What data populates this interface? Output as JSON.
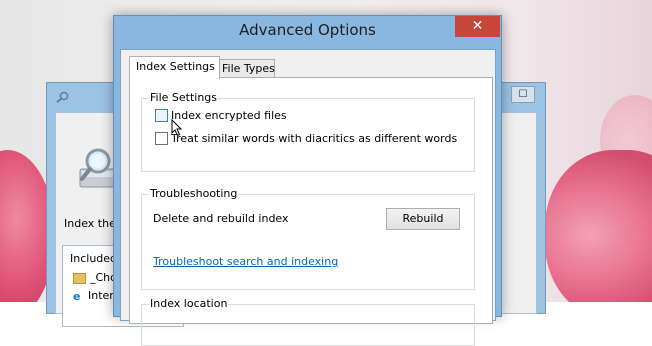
{
  "background_window": {
    "maximize_glyph": "☐",
    "index_these_label": "Index these",
    "included_header": "Included",
    "rows": [
      "_Choo",
      "Intern"
    ]
  },
  "dialog": {
    "title": "Advanced Options",
    "close_glyph": "✕",
    "tabs": [
      {
        "label": "Index Settings",
        "active": true
      },
      {
        "label": "File Types",
        "active": false
      }
    ],
    "file_settings": {
      "legend": "File Settings",
      "options": [
        {
          "label": "Index encrypted files",
          "checked": false
        },
        {
          "label": "Treat similar words with diacritics as different words",
          "checked": false
        }
      ]
    },
    "troubleshooting": {
      "legend": "Troubleshooting",
      "delete_rebuild_label": "Delete and rebuild index",
      "rebuild_button": "Rebuild",
      "troubleshoot_link": "Troubleshoot search and indexing"
    },
    "index_location": {
      "legend": "Index location"
    }
  },
  "colors": {
    "title_bar": "#8ab7df",
    "close_button": "#c7463a",
    "link": "#0a63b8"
  }
}
